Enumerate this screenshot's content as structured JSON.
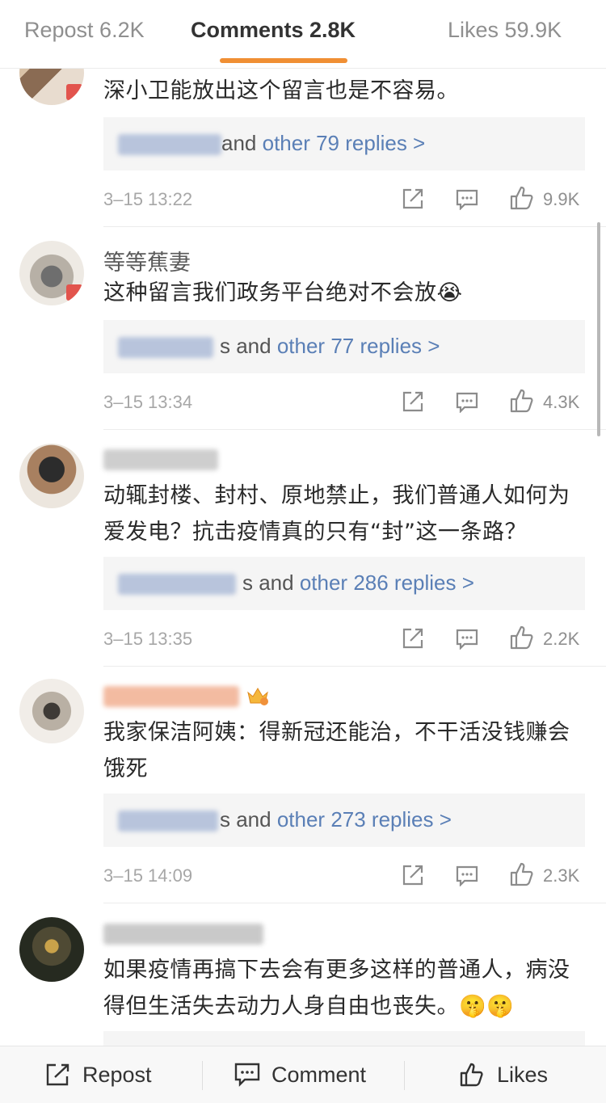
{
  "tabs": [
    {
      "label": "Repost 6.2K"
    },
    {
      "label": "Comments 2.8K"
    },
    {
      "label": "Likes 59.9K"
    }
  ],
  "comments": [
    {
      "text": "深小卫能放出这个留言也是不容易。",
      "reply_suffix": " and ",
      "reply_link": "other 79 replies >",
      "time": "3–15 13:22",
      "likes": "9.9K"
    },
    {
      "username": "等等蕉妻",
      "text": "这种留言我们政务平台绝对不会放😭",
      "reply_suffix": "s and ",
      "reply_link": "other 77 replies >",
      "time": "3–15 13:34",
      "likes": "4.3K"
    },
    {
      "text": "动辄封楼、封村、原地禁止，我们普通人如何为爱发电？抗击疫情真的只有“封”这一条路？",
      "reply_suffix": "s and ",
      "reply_link": "other 286 replies >",
      "time": "3–15 13:35",
      "likes": "2.2K"
    },
    {
      "text": "我家保洁阿姨：得新冠还能治，不干活没钱赚会饿死",
      "reply_suffix": "s and ",
      "reply_link": "other 273 replies >",
      "time": "3–15 14:09",
      "likes": "2.3K"
    },
    {
      "text": "如果疫情再搞下去会有更多这样的普通人，病没得但生活失去动力人身自由也丧失。🤫🤫"
    }
  ],
  "bottom": {
    "repost": "Repost",
    "comment": "Comment",
    "likes": "Likes"
  },
  "colors": {
    "accent": "#f08f34",
    "link": "#5a7fb6"
  },
  "icons": [
    "repost-icon",
    "comment-icon",
    "like-icon",
    "crown-icon"
  ]
}
